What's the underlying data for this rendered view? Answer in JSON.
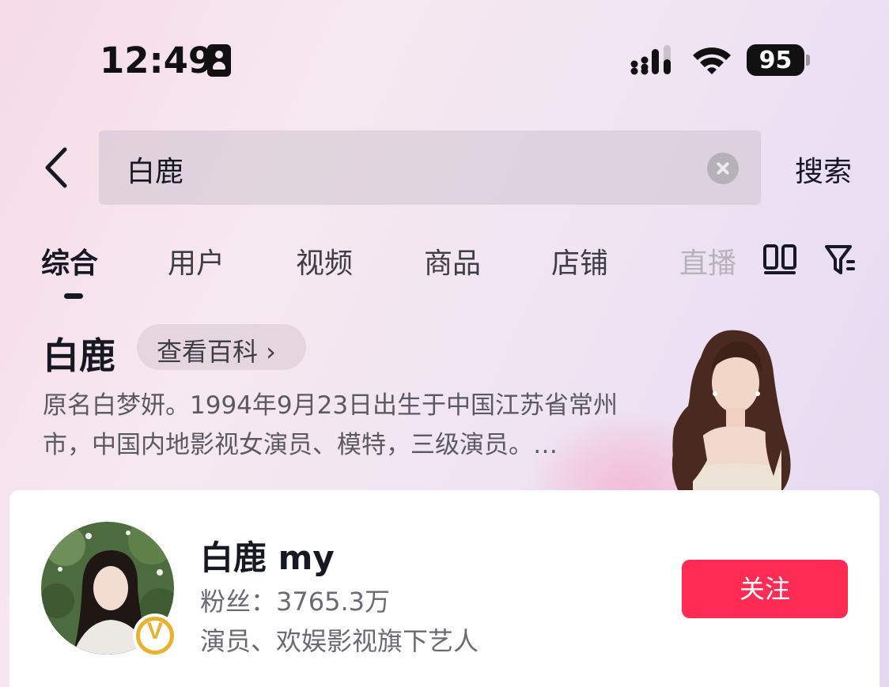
{
  "status_bar": {
    "time": "12:49",
    "battery": "95",
    "icons": [
      "contact-card-icon",
      "signal-icon",
      "wifi-icon",
      "battery-icon"
    ]
  },
  "search": {
    "query": "白鹿",
    "button_label": "搜索"
  },
  "tabs": [
    {
      "label": "综合",
      "active": true
    },
    {
      "label": "用户"
    },
    {
      "label": "视频"
    },
    {
      "label": "商品"
    },
    {
      "label": "店铺"
    },
    {
      "label": "直播"
    }
  ],
  "baike": {
    "title": "白鹿",
    "link_label": "查看百科 ›",
    "description": "原名白梦妍。1994年9月23日出生于中国江苏省常州市，中国内地影视女演员、模特，三级演员。…"
  },
  "user_card": {
    "name": "白鹿 my",
    "fans": "粉丝：3765.3万",
    "bio": "演员、欢娱影视旗下艺人",
    "follow_label": "关注",
    "badge": "V"
  },
  "colors": {
    "accent": "#fe2c55",
    "verify_gold": "#e8b22d"
  }
}
